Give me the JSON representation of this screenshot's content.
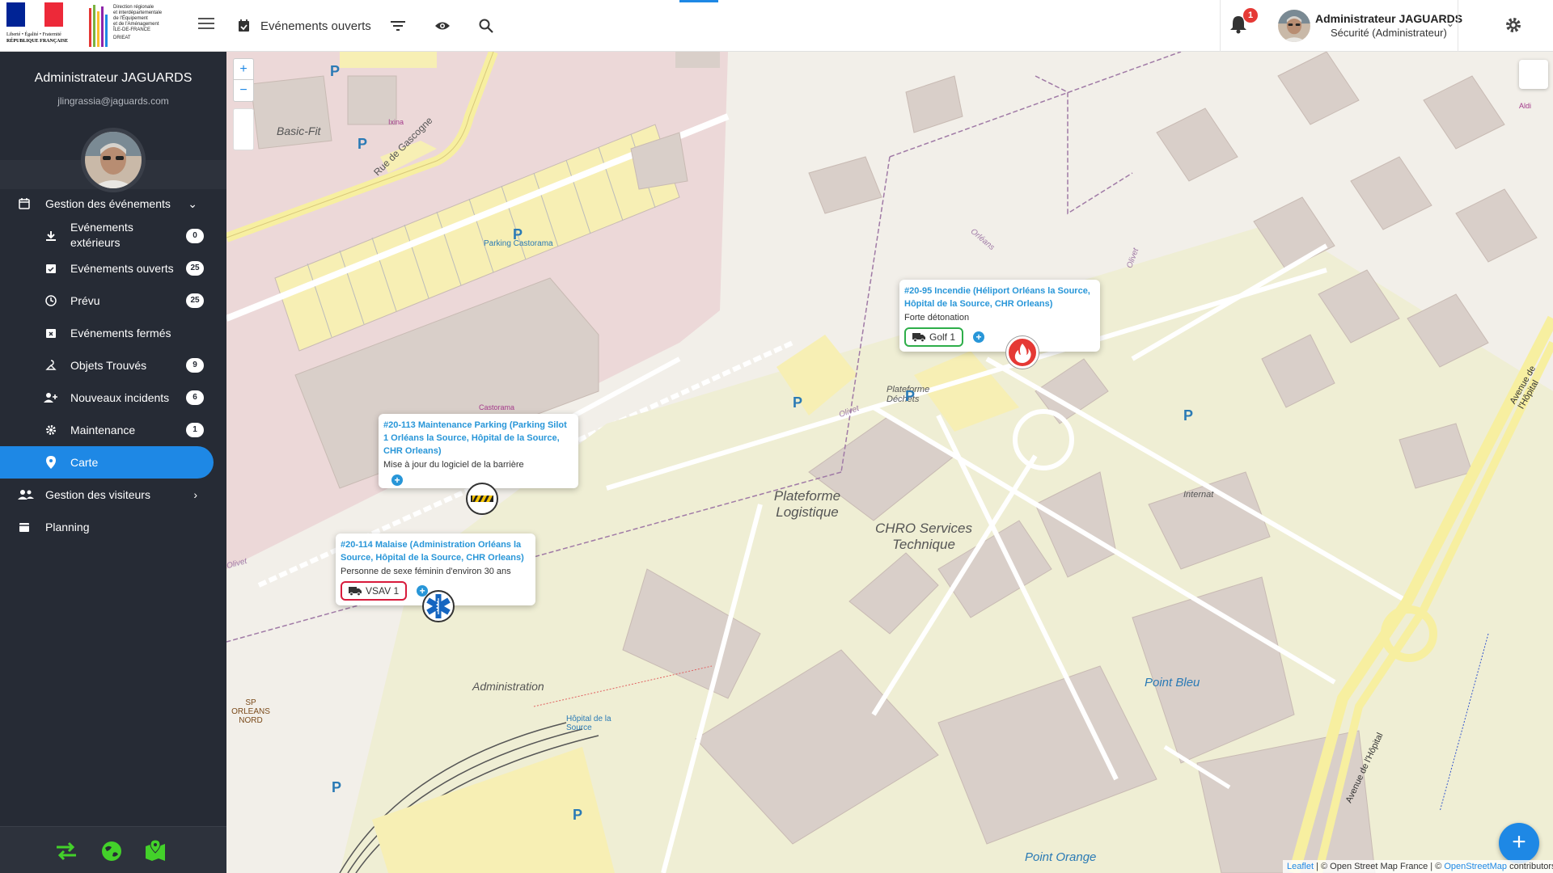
{
  "sidebar": {
    "logos": {
      "republique_text": [
        "Liberté • Égalité • Fraternité",
        "RÉPUBLIQUE FRANÇAISE"
      ],
      "drieat_text": [
        "Direction régionale",
        "et interdépartementale",
        "de l'Équipement",
        "et de l'Aménagement",
        "ÎLE-DE-FRANCE",
        "DRIEAT"
      ]
    },
    "user": {
      "name": "Administrateur JAGUARDS",
      "email": "jlingrassia@jaguards.com"
    },
    "menu": {
      "gestion_evenements": "Gestion des événements",
      "evenements_exterieurs": "Evénements extérieurs",
      "evenements_exterieurs_count": "0",
      "evenements_ouverts": "Evénements ouverts",
      "evenements_ouverts_count": "25",
      "prevu": "Prévu",
      "prevu_count": "25",
      "evenements_fermes": "Evénements fermés",
      "objets_trouves": "Objets Trouvés",
      "objets_trouves_count": "9",
      "nouveaux_incidents": "Nouveaux incidents",
      "nouveaux_incidents_count": "6",
      "maintenance": "Maintenance",
      "maintenance_count": "1",
      "carte": "Carte",
      "gestion_visiteurs": "Gestion des visiteurs",
      "planning": "Planning"
    },
    "accent": "#1e88e5",
    "bottom_icon_color": "#43d12a"
  },
  "topbar": {
    "title": "Evénements ouverts",
    "notification_count": "1",
    "user_name": "Administrateur JAGUARDS",
    "user_role": "Sécurité (Administrateur)"
  },
  "map": {
    "labels": {
      "basic_fit": "Basic-Fit",
      "ixina": "Ixina",
      "rue_gascogne": "Rue de Gascogne",
      "parking_castorama": "Parking Castorama",
      "castorama": "Castorama",
      "plateforme_logistique": "Plateforme Logistique",
      "plateforme_dechets": "Plateforme Déchets",
      "chro_services": "CHRO Services Technique",
      "internat": "Internat",
      "point_bleu": "Point Bleu",
      "point_orange": "Point Orange",
      "administration": "Administration",
      "olivet1": "Olivet",
      "olivet2": "Olivet",
      "olivet3": "Olivet",
      "orleans1": "Orléans",
      "orleans2": "Orléans",
      "hopital_source": "Hôpital de la Source",
      "sp_orleans": "SP ORLEANS NORD",
      "avenue_hopital": "Avenue de l'Hôpital",
      "aldi": "Aldi",
      "p": "P"
    },
    "popups": [
      {
        "title": "#20-95 Incendie (Héliport Orléans la Source, Hôpital de la Source, CHR Orleans)",
        "description": "Forte détonation",
        "vehicle": "Golf 1",
        "vehicle_color": "#2eae4a",
        "marker": "fire-icon",
        "marker_color": "#e53935"
      },
      {
        "title": "#20-113 Maintenance Parking (Parking Silot 1 Orléans la Source, Hôpital de la Source, CHR Orleans)",
        "description": "Mise à jour du logiciel de la barrière",
        "vehicle": "",
        "marker": "barrier-icon"
      },
      {
        "title": "#20-114 Malaise (Administration Orléans la Source, Hôpital de la Source, CHR Orleans)",
        "description": "Personne de sexe féminin d'environ 30 ans",
        "vehicle": "VSAV 1",
        "vehicle_color": "#d81b3c",
        "marker": "medical-star-icon",
        "marker_color": "#1565c0"
      }
    ],
    "zoom_in": "+",
    "zoom_out": "−",
    "fab_label": "+",
    "attribution": {
      "leaflet": "Leaflet",
      "osm_france": " | © Open Street Map France | © ",
      "osm": "OpenStreetMap",
      "contributors": " contributors"
    }
  }
}
